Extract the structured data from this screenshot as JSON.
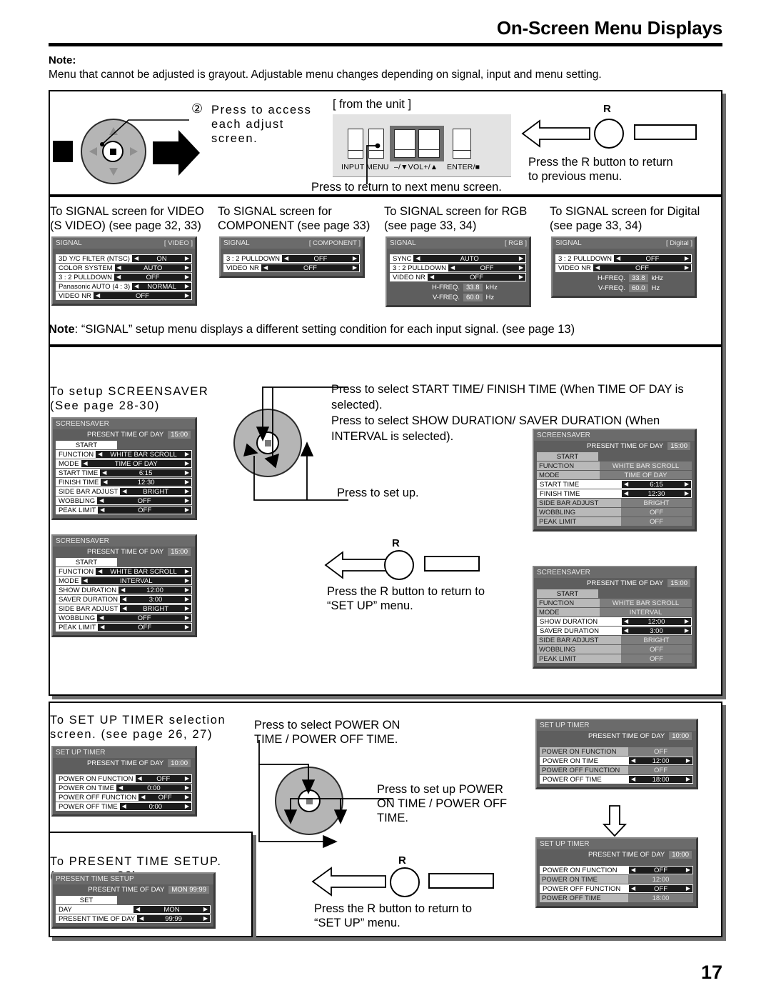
{
  "header": {
    "title": "On-Screen Menu Displays",
    "note_label": "Note:",
    "note_text": "Menu that cannot be adjusted is grayout. Adjustable menu changes depending on signal, input and menu setting."
  },
  "page_number": "17",
  "section_top": {
    "step_number": "②",
    "step_text": "Press to access\neach adjust\nscreen.",
    "unit_caption": "[ from the unit ]",
    "unit_buttons": [
      "INPUT",
      "MENU",
      "–/▼VOL+/▲",
      "ENTER/■"
    ],
    "unit_return_text": "Press to return to next menu screen.",
    "r_label": "R",
    "r_text": "Press the R button to return\nto previous menu."
  },
  "signal_section": {
    "captions": [
      "To SIGNAL screen for VIDEO\n(S VIDEO) (see page 32, 33)",
      "To SIGNAL screen for\n COMPONENT (see page 33)",
      "To SIGNAL screen for RGB\n(see page 33, 34)",
      "To SIGNAL screen for Digital\n(see page 33, 34)"
    ],
    "menus": [
      {
        "title": "SIGNAL",
        "badge": "[ VIDEO ]",
        "rows": [
          {
            "label": "3D Y/C FILTER (NTSC)",
            "value": "ON"
          },
          {
            "label": "COLOR SYSTEM",
            "value": "AUTO"
          },
          {
            "label": "3 : 2 PULLDOWN",
            "value": "OFF"
          },
          {
            "label": "Panasonic AUTO (4 : 3)",
            "value": "NORMAL"
          },
          {
            "label": "VIDEO NR",
            "value": "OFF"
          }
        ],
        "freq": []
      },
      {
        "title": "SIGNAL",
        "badge": "[ COMPONENT ]",
        "rows": [
          {
            "label": "3 : 2 PULLDOWN",
            "value": "OFF"
          },
          {
            "label": "VIDEO NR",
            "value": "OFF"
          }
        ],
        "freq": []
      },
      {
        "title": "SIGNAL",
        "badge": "[ RGB ]",
        "rows": [
          {
            "label": "SYNC",
            "value": "AUTO"
          },
          {
            "label": "3 : 2 PULLDOWN",
            "value": "OFF"
          },
          {
            "label": "VIDEO NR",
            "value": "OFF"
          }
        ],
        "freq": [
          {
            "label": "H-FREQ.",
            "value": "33.8",
            "unit": "kHz"
          },
          {
            "label": "V-FREQ.",
            "value": "60.0",
            "unit": "Hz"
          }
        ]
      },
      {
        "title": "SIGNAL",
        "badge": "[ Digital ]",
        "rows": [
          {
            "label": "3 : 2 PULLDOWN",
            "value": "OFF"
          },
          {
            "label": "VIDEO NR",
            "value": "OFF"
          }
        ],
        "freq": [
          {
            "label": "H-FREQ.",
            "value": "33.8",
            "unit": "kHz"
          },
          {
            "label": "V-FREQ.",
            "value": "60.0",
            "unit": "Hz"
          }
        ]
      }
    ],
    "note_label": "Note",
    "note_text": ":  “SIGNAL” setup menu displays a different setting condition for each input signal. (see page 13)"
  },
  "screensaver_section": {
    "caption": "To setup SCREENSAVER\n(See page 28-30)",
    "select_text": "Press to select START TIME/ FINISH TIME (When TIME OF DAY is selected).\nPress to select SHOW DURATION/ SAVER DURATION (When INTERVAL is selected).",
    "setup_text": "Press to set up.",
    "r_label": "R",
    "r_text": "Press the R button to return to\n“SET UP” menu.",
    "menu_title": "SCREENSAVER",
    "present_label": "PRESENT  TIME OF DAY",
    "present_value": "15:00",
    "start_button": "START",
    "menu_left_timeofday": {
      "rows": [
        {
          "label": "FUNCTION",
          "value": "WHITE BAR SCROLL",
          "state": "active"
        },
        {
          "label": "MODE",
          "value": "TIME OF DAY",
          "state": "active"
        },
        {
          "label": "START TIME",
          "value": "6:15",
          "state": "active"
        },
        {
          "label": "FINISH TIME",
          "value": "12:30",
          "state": "active"
        },
        {
          "label": "SIDE BAR ADJUST",
          "value": "BRIGHT",
          "state": "active"
        },
        {
          "label": "WOBBLING",
          "value": "OFF",
          "state": "active"
        },
        {
          "label": "PEAK LIMIT",
          "value": "OFF",
          "state": "active"
        }
      ]
    },
    "menu_left_interval": {
      "rows": [
        {
          "label": "FUNCTION",
          "value": "WHITE BAR SCROLL",
          "state": "active"
        },
        {
          "label": "MODE",
          "value": "INTERVAL",
          "state": "active"
        },
        {
          "label": "SHOW DURATION",
          "value": "12:00",
          "state": "active"
        },
        {
          "label": "SAVER DURATION",
          "value": "3:00",
          "state": "active"
        },
        {
          "label": "SIDE BAR ADJUST",
          "value": "BRIGHT",
          "state": "active"
        },
        {
          "label": "WOBBLING",
          "value": "OFF",
          "state": "active"
        },
        {
          "label": "PEAK LIMIT",
          "value": "OFF",
          "state": "active"
        }
      ]
    },
    "menu_right_timeofday": {
      "rows": [
        {
          "label": "FUNCTION",
          "value": "WHITE BAR SCROLL",
          "state": "grey"
        },
        {
          "label": "MODE",
          "value": "TIME OF DAY",
          "state": "grey"
        },
        {
          "label": "START TIME",
          "value": "6:15",
          "state": "active"
        },
        {
          "label": "FINISH TIME",
          "value": "12:30",
          "state": "active"
        },
        {
          "label": "SIDE BAR ADJUST",
          "value": "BRIGHT",
          "state": "grey"
        },
        {
          "label": "WOBBLING",
          "value": "OFF",
          "state": "grey"
        },
        {
          "label": "PEAK LIMIT",
          "value": "OFF",
          "state": "grey"
        }
      ]
    },
    "menu_right_interval": {
      "rows": [
        {
          "label": "FUNCTION",
          "value": "WHITE BAR SCROLL",
          "state": "grey"
        },
        {
          "label": "MODE",
          "value": "INTERVAL",
          "state": "grey"
        },
        {
          "label": "SHOW DURATION",
          "value": "12:00",
          "state": "active"
        },
        {
          "label": "SAVER DURATION",
          "value": "3:00",
          "state": "active"
        },
        {
          "label": "SIDE BAR ADJUST",
          "value": "BRIGHT",
          "state": "grey"
        },
        {
          "label": "WOBBLING",
          "value": "OFF",
          "state": "grey"
        },
        {
          "label": "PEAK LIMIT",
          "value": "OFF",
          "state": "grey"
        }
      ]
    }
  },
  "timer_section": {
    "caption": "To SET UP TIMER selection\nscreen. (see page 26, 27)",
    "select_text": "Press to select POWER ON\nTIME / POWER OFF TIME.",
    "setup_text": "Press to set up POWER\nON TIME / POWER OFF\nTIME.",
    "r_label": "R",
    "r_text": "Press the R button to return to\n“SET UP” menu.",
    "menu_title": "SET UP TIMER",
    "present_label": "PRESENT  TIME OF DAY",
    "present_value": "10:00",
    "menu_left": {
      "rows": [
        {
          "label": "POWER ON FUNCTION",
          "value": "OFF",
          "state": "active"
        },
        {
          "label": "POWER ON TIME",
          "value": "0:00",
          "state": "active"
        },
        {
          "label": "POWER OFF FUNCTION",
          "value": "OFF",
          "state": "active"
        },
        {
          "label": "POWER OFF TIME",
          "value": "0:00",
          "state": "active"
        }
      ]
    },
    "menu_right_top": {
      "rows": [
        {
          "label": "POWER ON FUNCTION",
          "value": "OFF",
          "state": "grey"
        },
        {
          "label": "POWER ON TIME",
          "value": "12:00",
          "state": "active"
        },
        {
          "label": "POWER OFF FUNCTION",
          "value": "OFF",
          "state": "grey"
        },
        {
          "label": "POWER OFF TIME",
          "value": "18:00",
          "state": "active"
        }
      ]
    },
    "menu_right_bottom": {
      "rows": [
        {
          "label": "POWER ON FUNCTION",
          "value": "OFF",
          "state": "active"
        },
        {
          "label": "POWER ON TIME",
          "value": "12:00",
          "state": "grey"
        },
        {
          "label": "POWER OFF FUNCTION",
          "value": "OFF",
          "state": "active"
        },
        {
          "label": "POWER OFF TIME",
          "value": "18:00",
          "state": "grey"
        }
      ]
    }
  },
  "present_time_section": {
    "caption": "To PRESENT TIME SETUP.\n(see page 26)",
    "menu_title": "PRESENT  TIME SETUP",
    "present_label": "PRESENT  TIME OF DAY",
    "present_value": "MON  99:99",
    "set_button": "SET",
    "rows": [
      {
        "label": "DAY",
        "value": "MON",
        "state": "active"
      },
      {
        "label": "PRESENT  TIME OF DAY",
        "value": "99:99",
        "state": "active"
      }
    ]
  }
}
